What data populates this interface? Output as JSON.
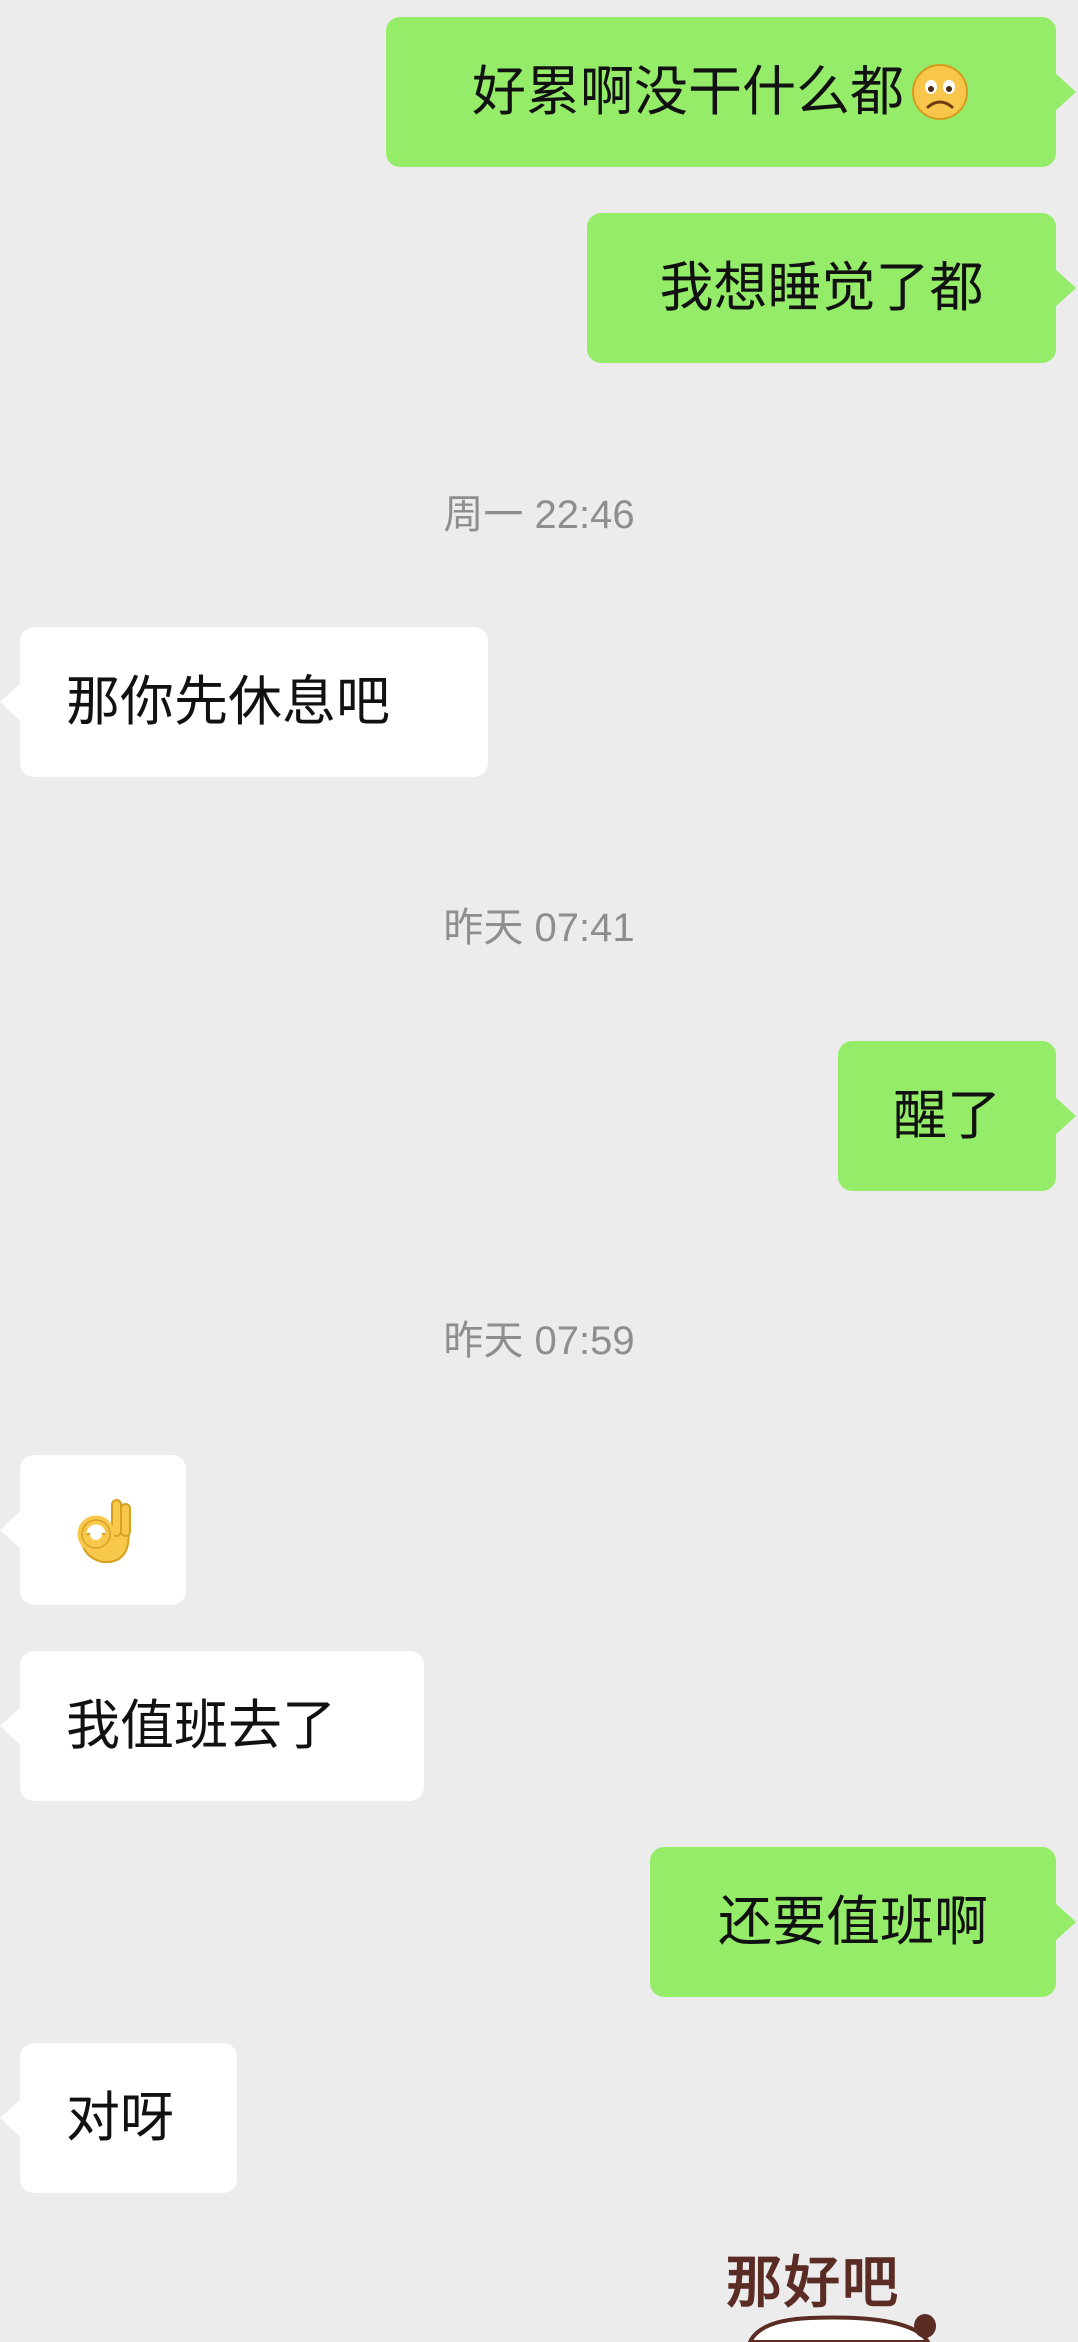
{
  "colors": {
    "background": "#ececec",
    "outgoing_bubble": "#95ec69",
    "incoming_bubble": "#ffffff",
    "timestamp": "#8e8e8e"
  },
  "messages": [
    {
      "id": "m1",
      "direction": "out",
      "text": "好累啊没干什么都",
      "emoji": "sad-face-icon"
    },
    {
      "id": "m2",
      "direction": "out",
      "text": "我想睡觉了都"
    },
    {
      "id": "t1",
      "type": "timestamp",
      "text": "周一 22:46"
    },
    {
      "id": "m3",
      "direction": "in",
      "text": "那你先休息吧"
    },
    {
      "id": "t2",
      "type": "timestamp",
      "text": "昨天 07:41"
    },
    {
      "id": "m4",
      "direction": "out",
      "text": "醒了"
    },
    {
      "id": "t3",
      "type": "timestamp",
      "text": "昨天 07:59"
    },
    {
      "id": "m5",
      "direction": "in",
      "emoji": "ok-hand-icon"
    },
    {
      "id": "m6",
      "direction": "in",
      "text": "我值班去了"
    },
    {
      "id": "m7",
      "direction": "out",
      "text": "还要值班啊"
    },
    {
      "id": "m8",
      "direction": "in",
      "text": "对呀"
    },
    {
      "id": "s1",
      "type": "sticker",
      "text": "那好吧"
    }
  ]
}
